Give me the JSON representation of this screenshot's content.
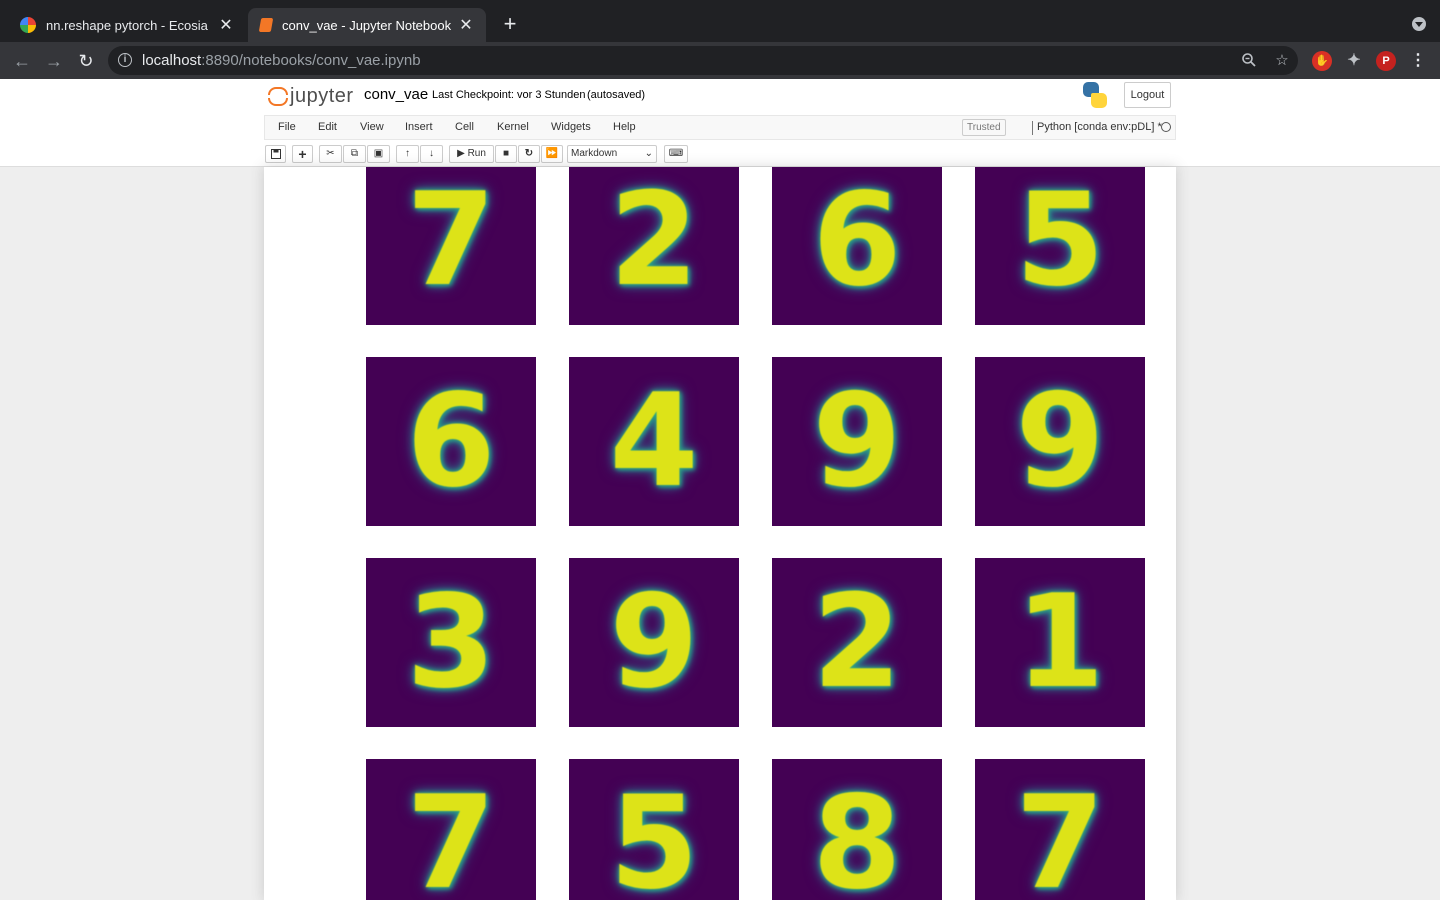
{
  "browser": {
    "tabs": [
      {
        "title": "nn.reshape pytorch - Ecosia",
        "active": false
      },
      {
        "title": "conv_vae - Jupyter Notebook",
        "active": true
      }
    ],
    "url_host": "localhost",
    "url_path": ":8890/notebooks/conv_vae.ipynb",
    "profile_initial": "P"
  },
  "jupyter": {
    "logo_text": "jupyter",
    "notebook_name": "conv_vae",
    "checkpoint": "Last Checkpoint: vor 3 Stunden",
    "autosaved": "(autosaved)",
    "logout_label": "Logout",
    "menu": [
      "File",
      "Edit",
      "View",
      "Insert",
      "Cell",
      "Kernel",
      "Widgets",
      "Help"
    ],
    "trusted_label": "Trusted",
    "kernel": "Python [conda env:pDL] *",
    "run_label": "Run",
    "cell_type": "Markdown"
  },
  "output": {
    "colormap": "viridis",
    "digits": [
      [
        "7",
        "2",
        "6",
        "5"
      ],
      [
        "6",
        "4",
        "9",
        "9"
      ],
      [
        "3",
        "9",
        "2",
        "1"
      ],
      [
        "7",
        "5",
        "8",
        "7"
      ]
    ]
  }
}
